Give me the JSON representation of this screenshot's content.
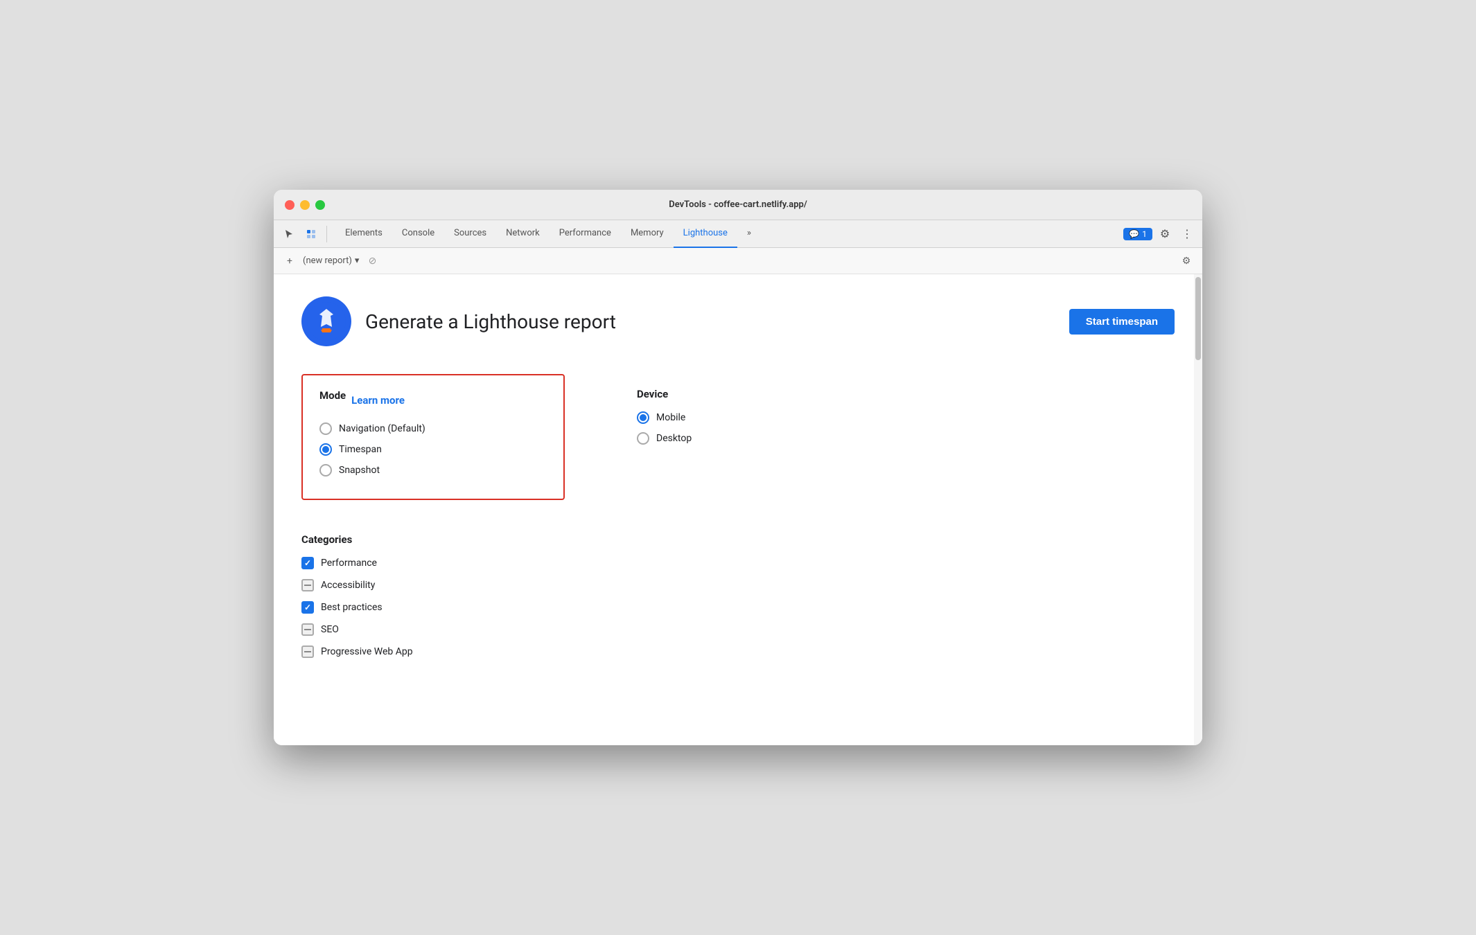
{
  "window": {
    "title": "DevTools - coffee-cart.netlify.app/"
  },
  "traffic_lights": {
    "red": "red",
    "yellow": "yellow",
    "green": "green"
  },
  "toolbar": {
    "tabs": [
      {
        "label": "Elements",
        "active": false
      },
      {
        "label": "Console",
        "active": false
      },
      {
        "label": "Sources",
        "active": false
      },
      {
        "label": "Network",
        "active": false
      },
      {
        "label": "Performance",
        "active": false
      },
      {
        "label": "Memory",
        "active": false
      },
      {
        "label": "Lighthouse",
        "active": true
      }
    ],
    "more_tabs": "»",
    "chat_badge": "1",
    "settings_icon": "⚙",
    "more_icon": "⋮"
  },
  "secondary_toolbar": {
    "add_icon": "+",
    "report_label": "(new report)",
    "dropdown_icon": "▾",
    "cancel_icon": "⊘",
    "gear_icon": "⚙"
  },
  "header": {
    "title": "Generate a Lighthouse report",
    "start_button": "Start timespan"
  },
  "mode": {
    "title": "Mode",
    "learn_more": "Learn more",
    "options": [
      {
        "label": "Navigation (Default)",
        "checked": false
      },
      {
        "label": "Timespan",
        "checked": true
      },
      {
        "label": "Snapshot",
        "checked": false
      }
    ]
  },
  "device": {
    "title": "Device",
    "options": [
      {
        "label": "Mobile",
        "checked": true
      },
      {
        "label": "Desktop",
        "checked": false
      }
    ]
  },
  "categories": {
    "title": "Categories",
    "items": [
      {
        "label": "Performance",
        "state": "checked"
      },
      {
        "label": "Accessibility",
        "state": "indeterminate"
      },
      {
        "label": "Best practices",
        "state": "checked"
      },
      {
        "label": "SEO",
        "state": "indeterminate"
      },
      {
        "label": "Progressive Web App",
        "state": "indeterminate"
      }
    ]
  }
}
